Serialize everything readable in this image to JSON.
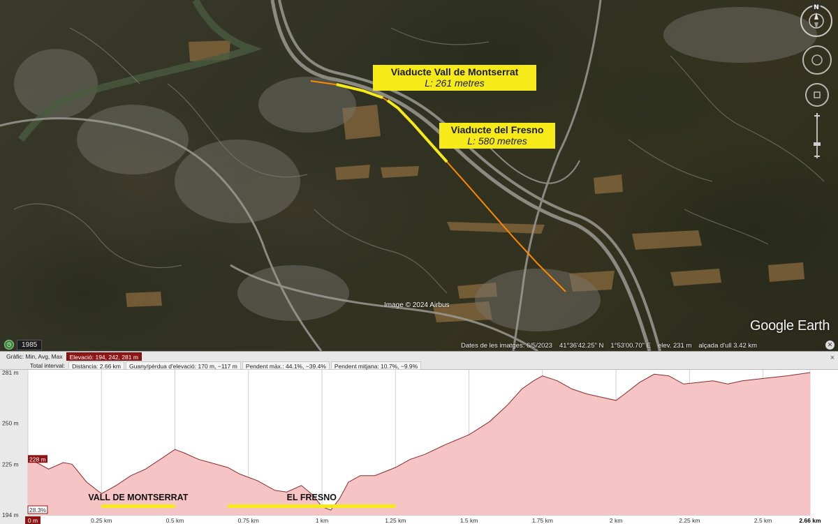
{
  "map": {
    "labels": {
      "vall": {
        "title": "Viaducte Vall de Montserrat",
        "sub": "L: 261 metres"
      },
      "fresno": {
        "title": "Viaducte del Fresno",
        "sub": "L: 580 metres"
      }
    },
    "image_credit": "Image © 2024 Airbus",
    "brand": "Google Earth",
    "compass_letter": "N",
    "historical_year": "1985",
    "status_bar": {
      "imagery_date": "Dates de les imatges: 6/5/2023",
      "latitude": "41°36'42.25\" N",
      "longitude": "1°53'00.70\" E",
      "elevation": "elev.   231 m",
      "eye_altitude": "alçada d'ull   3.42 km"
    },
    "route_color": "#ff8a00",
    "viaduct_color": "#f6ea18"
  },
  "elevation_profile": {
    "header": {
      "graph_label": "Gràfic: Min, Avg, Max",
      "elevation_value": "Elevació: 194, 242, 281 m",
      "total_label": "Total interval:",
      "distance": "Distància: 2.66 km",
      "gain_loss": "Guany/pèrdua d'elevació: 170 m, −117 m",
      "max_slope": "Pendent màx.: 44.1%, −39.4%",
      "avg_slope": "Pendent mitjana: 10.7%, −9.9%"
    },
    "close_label": "×"
  },
  "chart_data": {
    "type": "area",
    "title": "",
    "xlabel": "",
    "ylabel": "",
    "xlim": [
      0,
      2.66
    ],
    "ylim": [
      194,
      281
    ],
    "y_ticks": [
      {
        "value": 281,
        "label": "281 m"
      },
      {
        "value": 250,
        "label": "250 m"
      },
      {
        "value": 225,
        "label": "225 m"
      },
      {
        "value": 194,
        "label": "194 m"
      }
    ],
    "x_ticks": [
      {
        "value": 0,
        "label": "0 m"
      },
      {
        "value": 0.25,
        "label": "0.25 km"
      },
      {
        "value": 0.5,
        "label": "0.5 km"
      },
      {
        "value": 0.75,
        "label": "0.75 km"
      },
      {
        "value": 1,
        "label": "1 km"
      },
      {
        "value": 1.25,
        "label": "1.25 km"
      },
      {
        "value": 1.5,
        "label": "1.5 km"
      },
      {
        "value": 1.75,
        "label": "1.75 km"
      },
      {
        "value": 2,
        "label": "2 km"
      },
      {
        "value": 2.25,
        "label": "2.25 km"
      },
      {
        "value": 2.5,
        "label": "2.5 km"
      },
      {
        "value": 2.66,
        "label": "2.66 km"
      }
    ],
    "grid": true,
    "fill_color": "#f6c4c4",
    "line_color": "#8a2a2a",
    "series": [
      {
        "x": [
          0,
          0.03,
          0.07,
          0.12,
          0.15,
          0.2,
          0.25,
          0.3,
          0.35,
          0.4,
          0.45,
          0.5,
          0.53,
          0.58,
          0.62,
          0.68,
          0.72,
          0.78,
          0.84,
          0.88,
          0.93,
          0.97,
          1.0,
          1.03,
          1.06,
          1.09,
          1.13,
          1.18,
          1.25,
          1.3,
          1.35,
          1.42,
          1.5,
          1.57,
          1.63,
          1.68,
          1.72,
          1.75,
          1.8,
          1.85,
          1.9,
          1.95,
          2.0,
          2.03,
          2.08,
          2.13,
          2.18,
          2.23,
          2.28,
          2.33,
          2.38,
          2.43,
          2.48,
          2.53,
          2.58,
          2.66
        ],
        "y": [
          228,
          226,
          222,
          226,
          225,
          214,
          207,
          212,
          218,
          222,
          228,
          234,
          232,
          228,
          226,
          223,
          219,
          215,
          209,
          208,
          212,
          206,
          199,
          197,
          204,
          214,
          218,
          218,
          223,
          228,
          231,
          237,
          243,
          251,
          261,
          271,
          276,
          279,
          276,
          271,
          268,
          266,
          264,
          268,
          275,
          280,
          279,
          274,
          275,
          276,
          274,
          276,
          277,
          278,
          279,
          281
        ]
      }
    ],
    "start_marker": {
      "label": "228 m"
    },
    "grade_marker": {
      "label": "28.3%"
    },
    "annotations": [
      {
        "text": "VALL DE MONTSERRAT",
        "x_start": 0.25,
        "x_end": 0.5
      },
      {
        "text": "EL FRESNO",
        "x_start": 0.68,
        "x_end": 1.25
      }
    ]
  }
}
